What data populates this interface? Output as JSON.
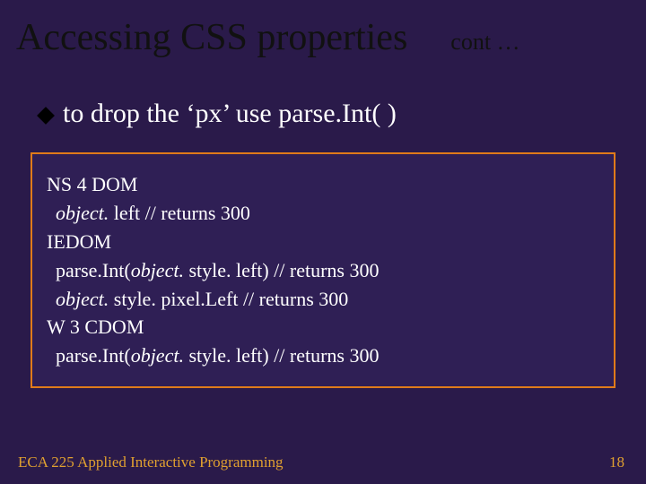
{
  "title": "Accessing CSS properties",
  "cont": "cont …",
  "bullet": "to drop the ‘px’ use parse.Int( )",
  "code": {
    "l1": "NS 4 DOM",
    "l2_obj": "object.",
    "l2_rest": " left  // returns 300",
    "l3": "IEDOM",
    "l4_a": " parse.Int(",
    "l4_obj": "object.",
    "l4_b": " style. left)  // returns 300",
    "l5_obj": "object.",
    "l5_rest": " style. pixel.Left  // returns 300",
    "l6": "W 3 CDOM",
    "l7_a": " parse.Int(",
    "l7_obj": "object.",
    "l7_b": " style. left)  // returns 300"
  },
  "footer": {
    "course": "ECA 225   Applied Interactive Programming",
    "page": "18"
  }
}
